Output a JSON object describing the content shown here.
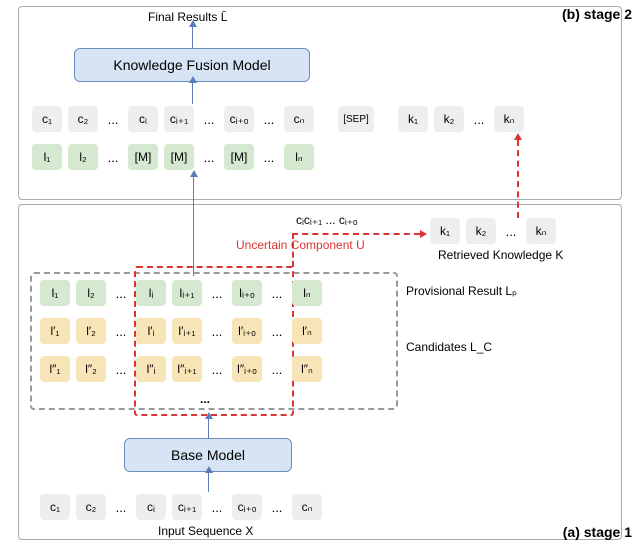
{
  "stage2_label": "(b) stage 2",
  "stage1_label": "(a) stage 1",
  "final_results_label": "Final Results L̄",
  "fusion_model_label": "Knowledge Fusion Model",
  "base_model_label": "Base Model",
  "input_label": "Input Sequence X",
  "provisional_label": "Provisional Result Lₚ",
  "candidates_label": "Candidates L_C",
  "retrieved_label": "Retrieved Knowledge K",
  "uncertain_label": "Uncertain Component U",
  "uncertain_seq": "cᵢcᵢ₊₁ ... cᵢ₊ₒ",
  "sep_label": "[SEP]",
  "mask_label": "[M]",
  "ellipsis": "...",
  "c_tokens": [
    "c₁",
    "c₂",
    "cᵢ",
    "cᵢ₊₁",
    "cᵢ₊ₒ",
    "cₙ"
  ],
  "l_tokens": [
    "l₁",
    "l₂",
    "lᵢ",
    "lᵢ₊₁",
    "lᵢ₊ₒ",
    "lₙ"
  ],
  "lp_tokens": [
    "l′₁",
    "l′₂",
    "l′ᵢ",
    "l′ᵢ₊₁",
    "l′ᵢ₊ₒ",
    "l′ₙ"
  ],
  "lpp_tokens": [
    "l″₁",
    "l″₂",
    "l″ᵢ",
    "l″ᵢ₊₁",
    "l″ᵢ₊ₒ",
    "l″ₙ"
  ],
  "k_tokens": [
    "k₁",
    "k₂",
    "kₙ"
  ]
}
